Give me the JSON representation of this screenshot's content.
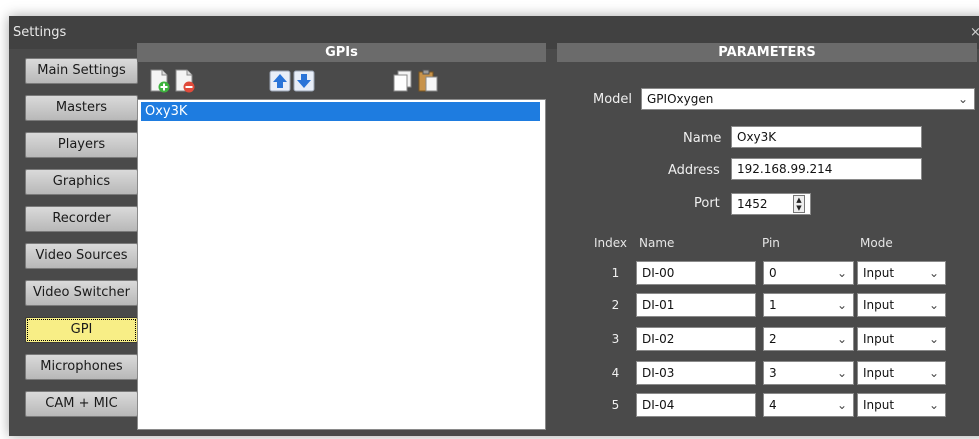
{
  "window": {
    "title": "Settings",
    "close_glyph": "×"
  },
  "sidebar": {
    "items": [
      {
        "label": "Main Settings"
      },
      {
        "label": "Masters"
      },
      {
        "label": "Players"
      },
      {
        "label": "Graphics"
      },
      {
        "label": "Recorder"
      },
      {
        "label": "Video Sources"
      },
      {
        "label": "Video Switcher"
      },
      {
        "label": "GPI",
        "active": true
      },
      {
        "label": "Microphones"
      },
      {
        "label": "CAM + MIC"
      }
    ]
  },
  "gpis": {
    "title": "GPIs",
    "toolbar": {
      "icons": [
        "add-document-icon",
        "remove-document-icon",
        "move-up-icon",
        "move-down-icon",
        "copy-icon",
        "paste-icon"
      ]
    },
    "list": [
      {
        "name": "Oxy3K",
        "selected": true
      }
    ]
  },
  "parameters": {
    "title": "PARAMETERS",
    "model_label": "Model",
    "model_value": "GPIOxygen",
    "name_label": "Name",
    "name_value": "Oxy3K",
    "address_label": "Address",
    "address_value": "192.168.99.214",
    "port_label": "Port",
    "port_value": "1452",
    "table": {
      "headers": {
        "index": "Index",
        "name": "Name",
        "pin": "Pin",
        "mode": "Mode"
      },
      "rows": [
        {
          "index": "1",
          "name": "DI-00",
          "pin": "0",
          "mode": "Input"
        },
        {
          "index": "2",
          "name": "DI-01",
          "pin": "1",
          "mode": "Input"
        },
        {
          "index": "3",
          "name": "DI-02",
          "pin": "2",
          "mode": "Input"
        },
        {
          "index": "4",
          "name": "DI-03",
          "pin": "3",
          "mode": "Input"
        },
        {
          "index": "5",
          "name": "DI-04",
          "pin": "4",
          "mode": "Input"
        }
      ]
    }
  },
  "colors": {
    "window_bg": "#4a4a4a",
    "header_bg": "#6b6b6b",
    "active_tab": "#f8ee86",
    "selection": "#1e7ce0"
  }
}
